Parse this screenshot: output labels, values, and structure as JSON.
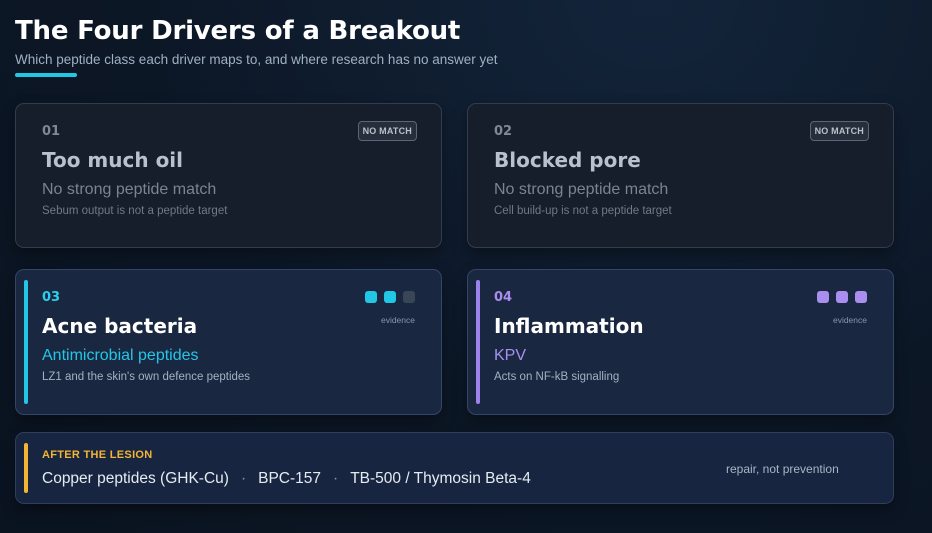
{
  "header": {
    "title": "The Four Drivers of a Breakout",
    "subtitle": "Which peptide class each driver maps to, and where research has no answer yet"
  },
  "drivers": [
    {
      "number": "01",
      "title": "Too much oil",
      "match": "No strong peptide match",
      "note": "Sebum output is not a peptide target",
      "badge": "NO MATCH"
    },
    {
      "number": "02",
      "title": "Blocked pore",
      "match": "No strong peptide match",
      "note": "Cell build-up is not a peptide target",
      "badge": "NO MATCH"
    },
    {
      "number": "03",
      "title": "Acne bacteria",
      "match": "Antimicrobial peptides",
      "note": "LZ1 and the skin's own defence peptides",
      "evidence_label": "evidence",
      "evidence_level": 2,
      "evidence_max": 3,
      "accent": "#22c7e6"
    },
    {
      "number": "04",
      "title": "Inflammation",
      "match": "KPV",
      "note": "Acts on NF-kB signalling",
      "evidence_label": "evidence",
      "evidence_level": 3,
      "evidence_max": 3,
      "accent": "#a98ef0"
    }
  ],
  "footer": {
    "label": "AFTER THE LESION",
    "items": [
      "Copper peptides (GHK-Cu)",
      "BPC-157",
      "TB-500 / Thymosin Beta-4"
    ],
    "separator": "·",
    "note": "repair, not prevention",
    "accent": "#f2b534"
  },
  "colors": {
    "dot_inactive": "#3a4658"
  }
}
